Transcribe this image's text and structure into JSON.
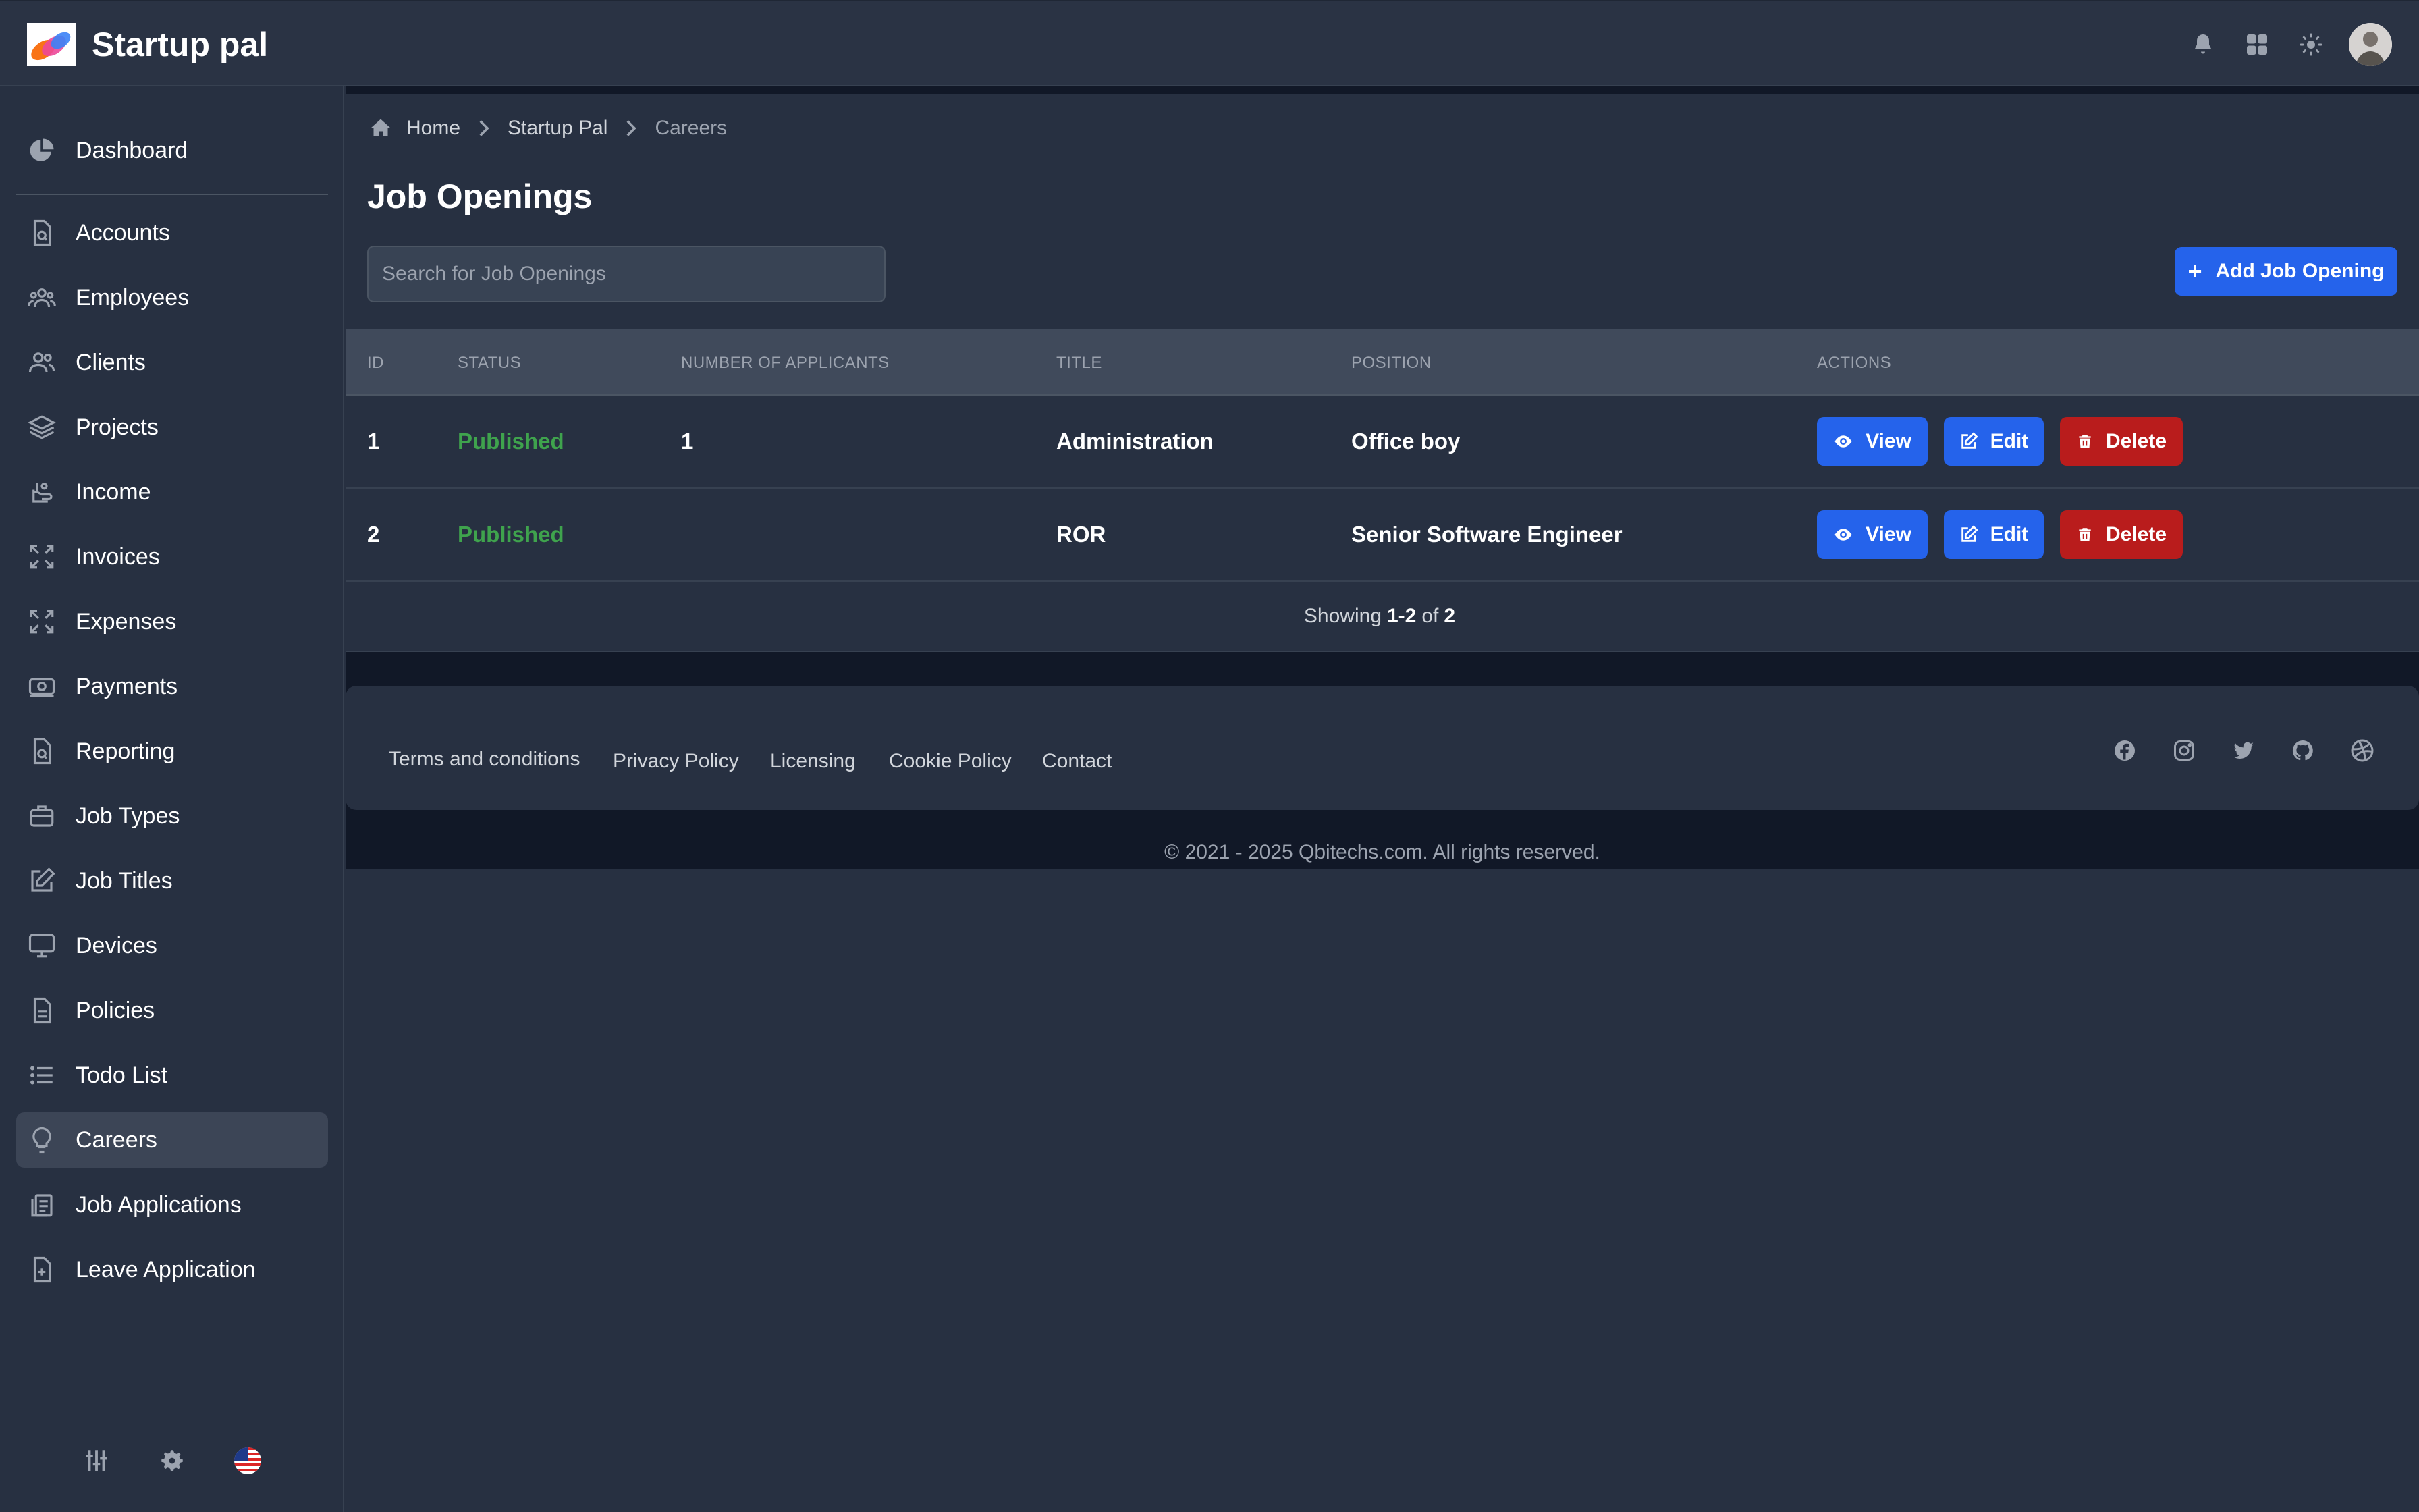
{
  "app": {
    "name": "Startup pal"
  },
  "sidebar": {
    "items": [
      {
        "label": "Dashboard",
        "icon": "pie-chart-icon"
      },
      {
        "label": "Accounts",
        "icon": "document-search-icon"
      },
      {
        "label": "Employees",
        "icon": "users-group-icon"
      },
      {
        "label": "Clients",
        "icon": "users-icon"
      },
      {
        "label": "Projects",
        "icon": "layers-icon"
      },
      {
        "label": "Income",
        "icon": "hand-coin-icon"
      },
      {
        "label": "Invoices",
        "icon": "expand-icon"
      },
      {
        "label": "Expenses",
        "icon": "expand-icon"
      },
      {
        "label": "Payments",
        "icon": "cash-icon"
      },
      {
        "label": "Reporting",
        "icon": "document-search-icon"
      },
      {
        "label": "Job Types",
        "icon": "briefcase-icon"
      },
      {
        "label": "Job Titles",
        "icon": "pencil-square-icon"
      },
      {
        "label": "Devices",
        "icon": "monitor-icon"
      },
      {
        "label": "Policies",
        "icon": "document-icon"
      },
      {
        "label": "Todo List",
        "icon": "list-icon"
      },
      {
        "label": "Careers",
        "icon": "lightbulb-icon"
      },
      {
        "label": "Job Applications",
        "icon": "clipboard-copy-icon"
      },
      {
        "label": "Leave Application",
        "icon": "document-plus-icon"
      }
    ],
    "active": "Careers"
  },
  "breadcrumb": {
    "home": "Home",
    "parent": "Startup Pal",
    "current": "Careers"
  },
  "page": {
    "title": "Job Openings",
    "search_placeholder": "Search for Job Openings",
    "add_label": "Add Job Opening"
  },
  "table": {
    "headers": {
      "id": "ID",
      "status": "Status",
      "applicants": "Number of applicants",
      "title": "Title",
      "position": "Position",
      "actions": "Actions"
    },
    "rows": [
      {
        "id": "1",
        "status": "Published",
        "applicants": "1",
        "title": "Administration",
        "position": "Office boy"
      },
      {
        "id": "2",
        "status": "Published",
        "applicants": "",
        "title": "ROR",
        "position": "Senior Software Engineer"
      }
    ],
    "actions": {
      "view": "View",
      "edit": "Edit",
      "delete": "Delete"
    }
  },
  "pager": {
    "prefix": "Showing",
    "range": "1-2",
    "of": "of",
    "total": "2"
  },
  "footer": {
    "links": [
      "Terms and conditions",
      "Privacy Policy",
      "Licensing",
      "Cookie Policy",
      "Contact"
    ],
    "social": [
      "facebook-icon",
      "instagram-icon",
      "twitter-icon",
      "github-icon",
      "dribbble-icon"
    ],
    "copyright": "© 2021 - 2025 Qbitechs.com. All rights reserved."
  },
  "colors": {
    "accent": "#2563eb",
    "danger": "#b91c1c",
    "success": "#3fa34d",
    "background": "#273041"
  }
}
